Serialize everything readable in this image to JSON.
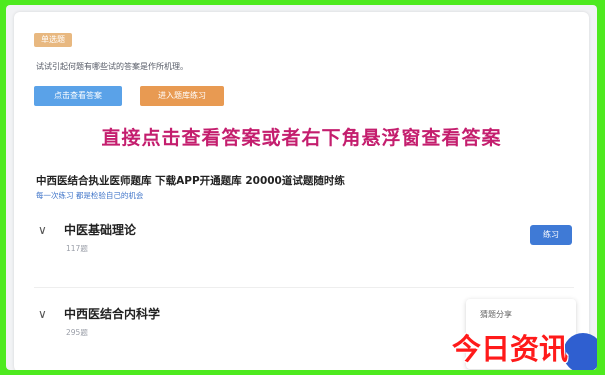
{
  "header": {
    "badge": "单选题",
    "intro": "试试引起何题有哪些试的答案是作所机理。"
  },
  "actions": {
    "view_answer_label": "点击查看答案",
    "enter_bank_label": "进入题库练习"
  },
  "promo": {
    "text": "直接点击查看答案或者右下角悬浮窗查看答案"
  },
  "bank": {
    "title": "中西医结合执业医师题库 下载APP开通题库 20000道试题随时练",
    "link": "每一次练习 都是检验自己的机会"
  },
  "chapters": [
    {
      "name": "中医基础理论",
      "count": "117题"
    },
    {
      "name": "中西医结合内科学",
      "count": "295题"
    }
  ],
  "practice_label": "练习",
  "float_panel": {
    "text": "猜题分享"
  },
  "watermark": "今日资讯",
  "colors": {
    "background": "#4eea1f",
    "promo": "#c41e6e",
    "primary_blue": "#3f7ad6",
    "orange": "#e89a52"
  }
}
